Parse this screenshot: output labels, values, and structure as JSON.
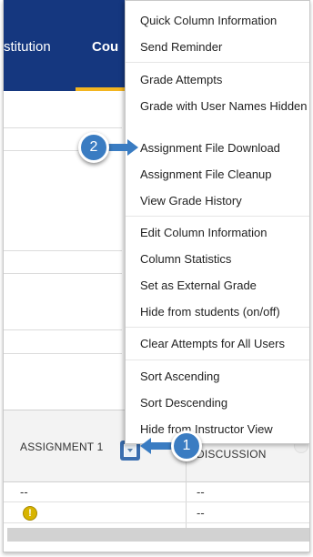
{
  "header": {
    "tab_institution": "stitution",
    "tab_courses": "Cou"
  },
  "grid": {
    "col_assignment": "ASSIGNMENT 1",
    "col_discussion": "DISCUSSION",
    "rows": [
      {
        "assignment": "--",
        "discussion": "--"
      },
      {
        "assignment": "",
        "discussion": "--"
      }
    ]
  },
  "menu": {
    "items": [
      "Quick Column Information",
      "Send Reminder",
      "Grade Attempts",
      "Grade with User Names Hidden",
      "Assignment File Download",
      "Assignment File Cleanup",
      "View Grade History",
      "Edit Column Information",
      "Column Statistics",
      "Set as External Grade",
      "Hide from students (on/off)",
      "Clear Attempts for All Users",
      "Sort Ascending",
      "Sort Descending",
      "Hide from Instructor View"
    ]
  },
  "callouts": {
    "step1": "1",
    "step2": "2"
  },
  "icons": {
    "warning": "warning-icon",
    "chevron": "chevron-down-icon"
  },
  "colors": {
    "header_bg": "#15377f",
    "active_tab_underline": "#f3b520",
    "callout": "#3a7cc2"
  }
}
